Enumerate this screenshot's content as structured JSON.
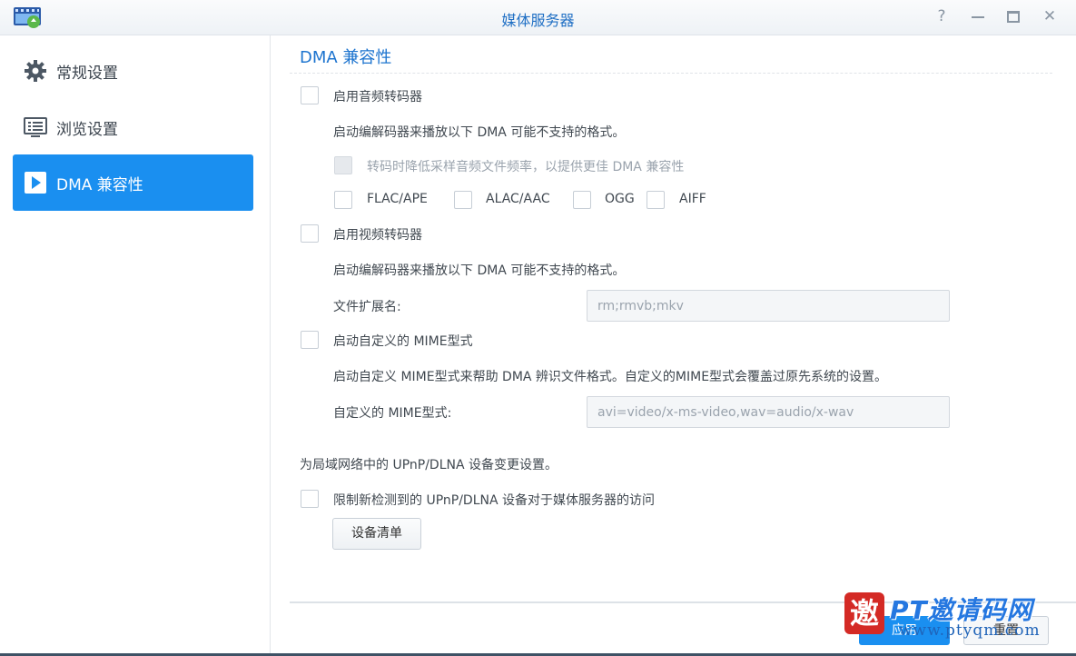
{
  "window": {
    "title": "媒体服务器",
    "help_glyph": "?",
    "close_glyph": "✕"
  },
  "sidebar": {
    "items": [
      {
        "label": "常规设置",
        "icon": "gear-icon",
        "active": false
      },
      {
        "label": "浏览设置",
        "icon": "list-icon",
        "active": false
      },
      {
        "label": "DMA 兼容性",
        "icon": "play-icon",
        "active": true
      }
    ]
  },
  "main": {
    "section_title": "DMA 兼容性",
    "audio": {
      "enable_label": "启用音频转码器",
      "enabled": false,
      "description": "启动编解码器来播放以下 DMA 可能不支持的格式。",
      "downsample_label": "转码时降低采样音频文件频率，以提供更佳 DMA 兼容性",
      "formats": [
        "FLAC/APE",
        "ALAC/AAC",
        "OGG",
        "AIFF"
      ]
    },
    "video": {
      "enable_label": "启用视频转码器",
      "enabled": false,
      "description": "启动编解码器来播放以下 DMA 可能不支持的格式。",
      "ext_label": "文件扩展名:",
      "ext_value": "rm;rmvb;mkv"
    },
    "mime": {
      "enable_label": "启动自定义的 MIME型式",
      "enabled": false,
      "description": "启动自定义 MIME型式来帮助 DMA 辨识文件格式。自定义的MIME型式会覆盖过原先系统的设置。",
      "field_label": "自定义的 MIME型式:",
      "field_value": "avi=video/x-ms-video,wav=audio/x-wav"
    },
    "upnp": {
      "description": "为局域网络中的 UPnP/DLNA 设备变更设置。",
      "restrict_label": "限制新检测到的 UPnP/DLNA 设备对于媒体服务器的访问",
      "device_list_button": "设备清单"
    }
  },
  "footer": {
    "apply_label": "应用",
    "reset_label": "重置"
  },
  "watermark": {
    "seal": "邀",
    "main": "PT邀请码网",
    "sub": "www.ptyqm.com"
  },
  "colors": {
    "accent": "#1a8ff0",
    "title_blue": "#1d74cf"
  }
}
